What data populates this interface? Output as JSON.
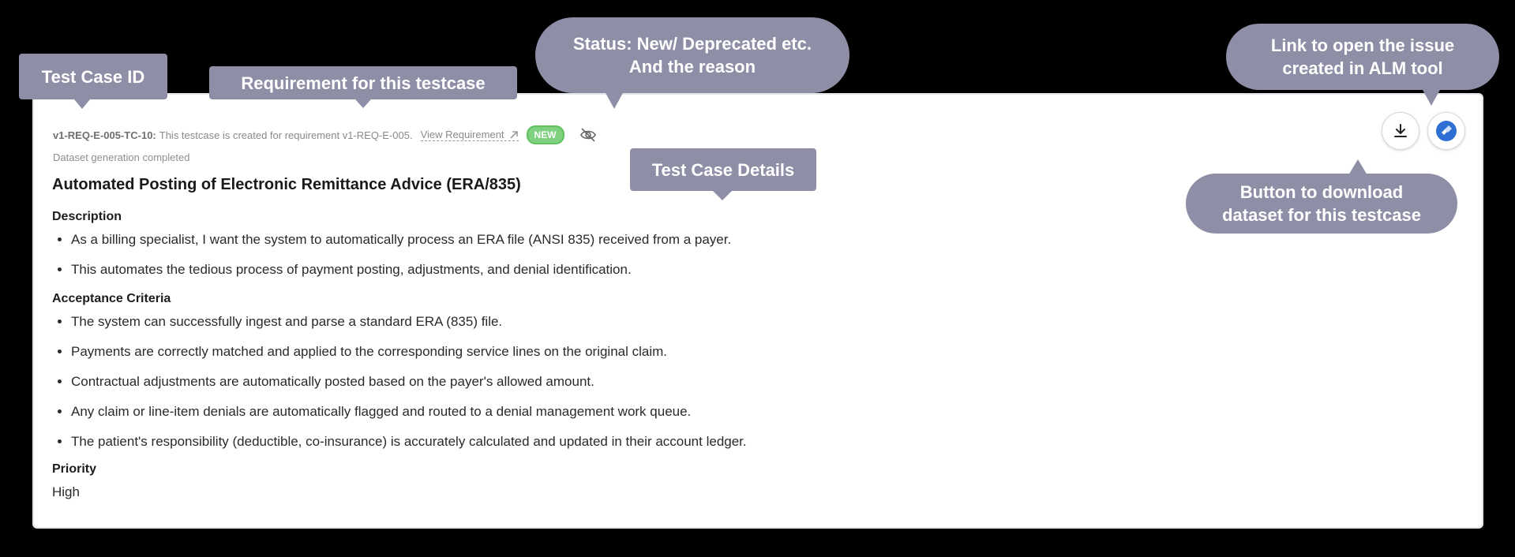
{
  "testcase": {
    "id": "v1-REQ-E-005-TC-10:",
    "requirement_text": "This testcase is created for requirement v1-REQ-E-005.",
    "view_requirement_label": "View Requirement",
    "status_badge": "NEW",
    "dataset_status": "Dataset generation completed",
    "title": "Automated Posting of Electronic Remittance Advice (ERA/835)",
    "description_label": "Description",
    "description_items": [
      "As a billing specialist, I want the system to automatically process an ERA file (ANSI 835) received from a payer.",
      "This automates the tedious process of payment posting, adjustments, and denial identification."
    ],
    "acceptance_label": "Acceptance Criteria",
    "acceptance_items": [
      "The system can successfully ingest and parse a standard ERA (835) file.",
      "Payments are correctly matched and applied to the corresponding service lines on the original claim.",
      "Contractual adjustments are automatically posted based on the payer's allowed amount.",
      "Any claim or line-item denials are automatically flagged and routed to a denial management work queue.",
      "The patient's responsibility (deductible, co-insurance) is accurately calculated and updated in their account ledger."
    ],
    "priority_label": "Priority",
    "priority_value": "High"
  },
  "icons": {
    "external_link": "arrow-up-right-icon",
    "visibility": "eye-off-icon",
    "download": "download-icon",
    "alm": "jira-icon"
  },
  "callouts": {
    "test_case_id": "Test Case ID",
    "requirement": "Requirement for this testcase",
    "status_line1": "Status: New/ Deprecated etc.",
    "status_line2": "And the reason",
    "details": "Test Case Details",
    "alm_line1": "Link to open the issue",
    "alm_line2": "created  in ALM tool",
    "download_line1": "Button to download",
    "download_line2": "dataset for this testcase"
  },
  "colors": {
    "callout": "#8f8ea7",
    "badge": "#7fd07f",
    "alm_blue": "#2f6fd3"
  }
}
